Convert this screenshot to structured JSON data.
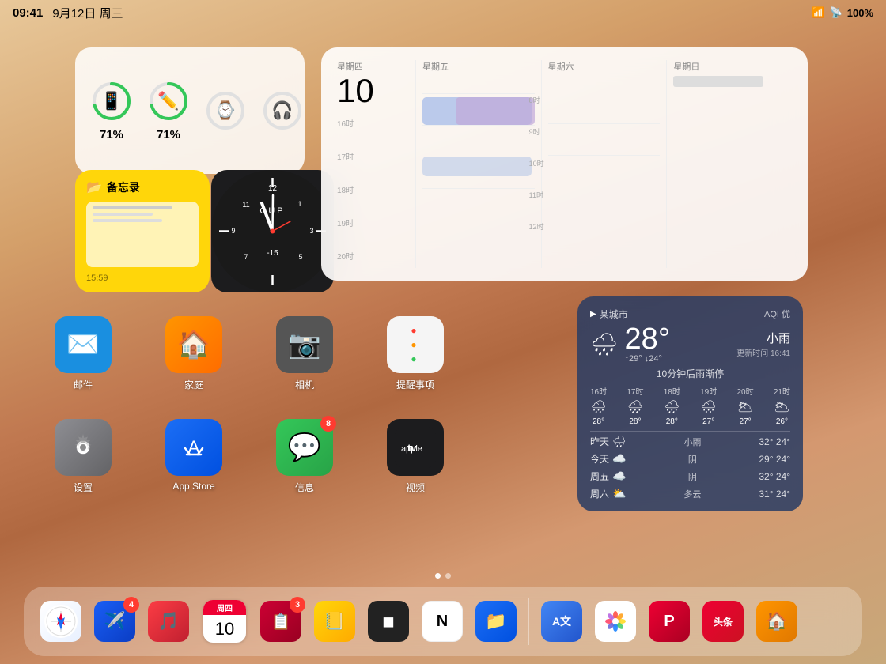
{
  "statusBar": {
    "time": "09:41",
    "date": "9月12日 周三",
    "battery": "100%"
  },
  "batteryWidget": {
    "device1": {
      "icon": "📱",
      "percent": "71%",
      "ring": 71
    },
    "device2": {
      "icon": "✏️",
      "percent": "71%",
      "ring": 71
    },
    "device3": {
      "icon": "⌚",
      "percent": "",
      "ring": 0
    },
    "device4": {
      "icon": "🎧",
      "percent": "",
      "ring": 0
    }
  },
  "notesWidget": {
    "title": "备忘录",
    "time": "15:59",
    "icon": "📂"
  },
  "clockWidget": {
    "text": "CUP",
    "hour": 11,
    "minute": 58,
    "second": 45
  },
  "calendarWidget": {
    "days": [
      "星期四",
      "星期五",
      "星期六",
      "星期日"
    ],
    "date": "10",
    "timeLabels": [
      "16时",
      "17时",
      "18时",
      "19时",
      "20时"
    ]
  },
  "weatherWidget": {
    "city": "某城市",
    "aqi": "AQI 优",
    "temp": "28°",
    "highTemp": "↑29°",
    "lowTemp": "↓24°",
    "condition": "小雨",
    "updated": "更新时间 16:41",
    "rainNotice": "10分钟后雨渐停",
    "hourly": [
      {
        "time": "16时",
        "icon": "🌧",
        "temp": "28°"
      },
      {
        "time": "17时",
        "icon": "🌧",
        "temp": "28°"
      },
      {
        "time": "18时",
        "icon": "🌧",
        "temp": "28°"
      },
      {
        "time": "19时",
        "icon": "🌧",
        "temp": "27°"
      },
      {
        "time": "20时",
        "icon": "🌥",
        "temp": "27°"
      },
      {
        "time": "21时",
        "icon": "🌥",
        "temp": "26°"
      }
    ],
    "daily": [
      {
        "day": "昨天",
        "icon": "🌧",
        "desc": "小雨",
        "high": "32°",
        "low": "24°"
      },
      {
        "day": "今天",
        "icon": "☁️",
        "desc": "阴",
        "high": "29°",
        "low": "24°"
      },
      {
        "day": "周五",
        "icon": "☁️",
        "desc": "阴",
        "high": "32°",
        "low": "24°"
      },
      {
        "day": "周六",
        "icon": "🌤",
        "desc": "多云",
        "high": "31°",
        "low": "24°"
      }
    ]
  },
  "homeApps": [
    {
      "label": "邮件",
      "icon": "✉️",
      "bg": "#1a8fe0",
      "badge": ""
    },
    {
      "label": "家庭",
      "icon": "🏠",
      "bg": "#ff9500",
      "badge": ""
    },
    {
      "label": "相机",
      "icon": "📷",
      "bg": "#555",
      "badge": ""
    },
    {
      "label": "提醒事项",
      "icon": "🔴",
      "bg": "#f5f5f5",
      "badge": ""
    },
    {
      "label": "设置",
      "icon": "⚙️",
      "bg": "#888",
      "badge": ""
    },
    {
      "label": "App Store",
      "icon": "🅰",
      "bg": "#1c6ef5",
      "badge": ""
    },
    {
      "label": "信息",
      "icon": "💬",
      "bg": "#34c759",
      "badge": "8"
    },
    {
      "label": "视频",
      "icon": "📺",
      "bg": "#1c1c1e",
      "badge": ""
    }
  ],
  "dock": [
    {
      "label": "Safari",
      "icon": "🧭",
      "bg": "#0076ff",
      "badge": ""
    },
    {
      "label": "邮件发送",
      "icon": "✈️",
      "bg": "#1c6ef5",
      "badge": "4"
    },
    {
      "label": "音乐",
      "icon": "🎵",
      "bg": "#fc3c44",
      "badge": ""
    },
    {
      "label": "日历",
      "icon": "📅",
      "bg": "#fff",
      "badge": ""
    },
    {
      "label": "OmniFocus",
      "icon": "📋",
      "bg": "#e03",
      "badge": "3"
    },
    {
      "label": "便签",
      "icon": "📒",
      "bg": "#ffd60a",
      "badge": ""
    },
    {
      "label": "App1",
      "icon": "◼",
      "bg": "#222",
      "badge": ""
    },
    {
      "label": "Notion",
      "icon": "📝",
      "bg": "#fff",
      "badge": ""
    },
    {
      "label": "文件",
      "icon": "📁",
      "bg": "#1c6ef5",
      "badge": ""
    },
    {
      "label": "翻译",
      "icon": "A文",
      "bg": "#4286f4",
      "badge": ""
    },
    {
      "label": "相册",
      "icon": "🌸",
      "bg": "#fff",
      "badge": ""
    },
    {
      "label": "P应用",
      "icon": "P",
      "bg": "#e03",
      "badge": ""
    },
    {
      "label": "头条",
      "icon": "头",
      "bg": "#e03",
      "badge": ""
    },
    {
      "label": "Home",
      "icon": "🏠",
      "bg": "#ff9500",
      "badge": ""
    }
  ],
  "pageDots": [
    {
      "active": true
    },
    {
      "active": false
    }
  ]
}
